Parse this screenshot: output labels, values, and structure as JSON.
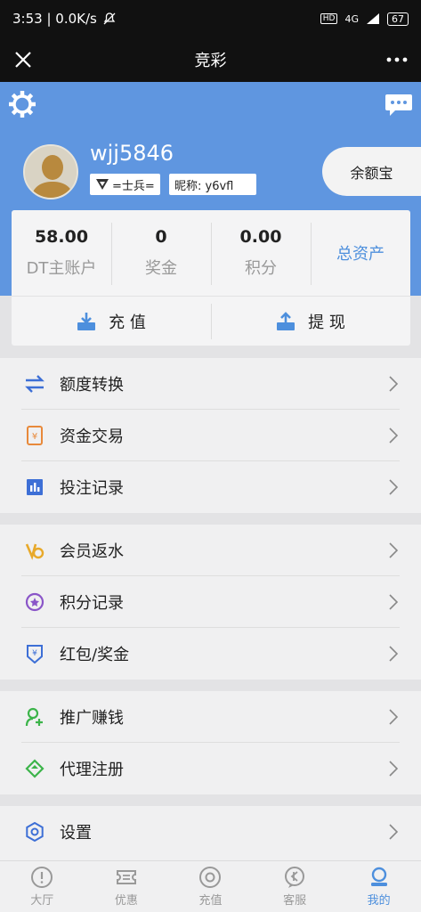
{
  "status_bar": {
    "time_speed": "3:53 | 0.0K/s",
    "network": "4G",
    "battery": "67"
  },
  "title_bar": {
    "title": "竞彩"
  },
  "profile": {
    "username": "wjj5846",
    "rank": "=士兵=",
    "nickname": "昵称: y6vfl",
    "yeb_label": "余额宝"
  },
  "stats": [
    {
      "value": "58.00",
      "label": "DT主账户"
    },
    {
      "value": "0",
      "label": "奖金"
    },
    {
      "value": "0.00",
      "label": "积分"
    }
  ],
  "total_assets_label": "总资产",
  "actions": {
    "deposit": "充 值",
    "withdraw": "提 现"
  },
  "menu_groups": [
    [
      {
        "label": "额度转换",
        "icon": "transfer-icon"
      },
      {
        "label": "资金交易",
        "icon": "funds-icon"
      },
      {
        "label": "投注记录",
        "icon": "bet-record-icon"
      }
    ],
    [
      {
        "label": "会员返水",
        "icon": "rebate-icon"
      },
      {
        "label": "积分记录",
        "icon": "points-icon"
      },
      {
        "label": "红包/奖金",
        "icon": "red-envelope-icon"
      }
    ],
    [
      {
        "label": "推广赚钱",
        "icon": "promote-icon"
      },
      {
        "label": "代理注册",
        "icon": "agent-icon"
      }
    ],
    [
      {
        "label": "设置",
        "icon": "settings-icon"
      }
    ]
  ],
  "tabs": [
    {
      "label": "大厅",
      "icon": "lobby-icon"
    },
    {
      "label": "优惠",
      "icon": "ticket-icon"
    },
    {
      "label": "充值",
      "icon": "recharge-icon"
    },
    {
      "label": "客服",
      "icon": "support-icon"
    },
    {
      "label": "我的",
      "icon": "profile-icon",
      "active": true
    }
  ],
  "colors": {
    "header_blue": "#5f96e0",
    "accent_blue": "#4d8fdd",
    "background": "#e3e3e5"
  }
}
